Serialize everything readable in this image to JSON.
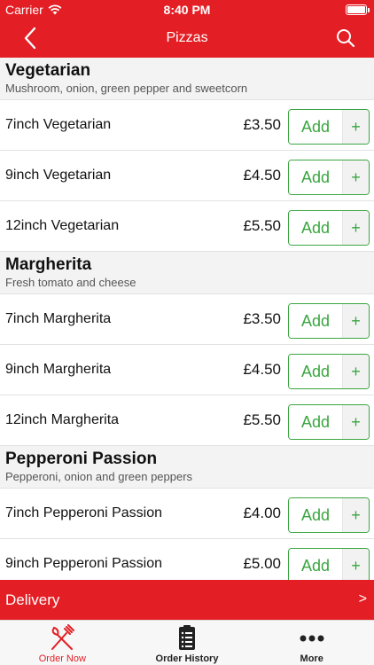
{
  "status": {
    "carrier": "Carrier",
    "time": "8:40 PM"
  },
  "nav": {
    "title": "Pizzas"
  },
  "sections": [
    {
      "name": "Vegetarian",
      "description": "Mushroom, onion, green pepper and sweetcorn",
      "items": [
        {
          "name": "7inch Vegetarian",
          "price": "£3.50",
          "add": "Add",
          "plus": "+"
        },
        {
          "name": "9inch Vegetarian",
          "price": "£4.50",
          "add": "Add",
          "plus": "+"
        },
        {
          "name": "12inch Vegetarian",
          "price": "£5.50",
          "add": "Add",
          "plus": "+"
        }
      ]
    },
    {
      "name": "Margherita",
      "description": "Fresh tomato and cheese",
      "items": [
        {
          "name": "7inch Margherita",
          "price": "£3.50",
          "add": "Add",
          "plus": "+"
        },
        {
          "name": "9inch Margherita",
          "price": "£4.50",
          "add": "Add",
          "plus": "+"
        },
        {
          "name": "12inch Margherita",
          "price": "£5.50",
          "add": "Add",
          "plus": "+"
        }
      ]
    },
    {
      "name": "Pepperoni Passion",
      "description": "Pepperoni, onion and green peppers",
      "items": [
        {
          "name": "7inch Pepperoni Passion",
          "price": "£4.00",
          "add": "Add",
          "plus": "+"
        },
        {
          "name": "9inch Pepperoni Passion",
          "price": "£5.00",
          "add": "Add",
          "plus": "+"
        }
      ]
    }
  ],
  "delivery": {
    "label": "Delivery",
    "arrow": ">"
  },
  "tabs": [
    {
      "label": "Order Now",
      "icon": "fork-knife-icon",
      "active": true
    },
    {
      "label": "Order History",
      "icon": "clipboard-icon",
      "active": false
    },
    {
      "label": "More",
      "icon": "more-dots-icon",
      "active": false
    }
  ],
  "colors": {
    "brand_red": "#e31e24",
    "add_green": "#3aa640"
  }
}
